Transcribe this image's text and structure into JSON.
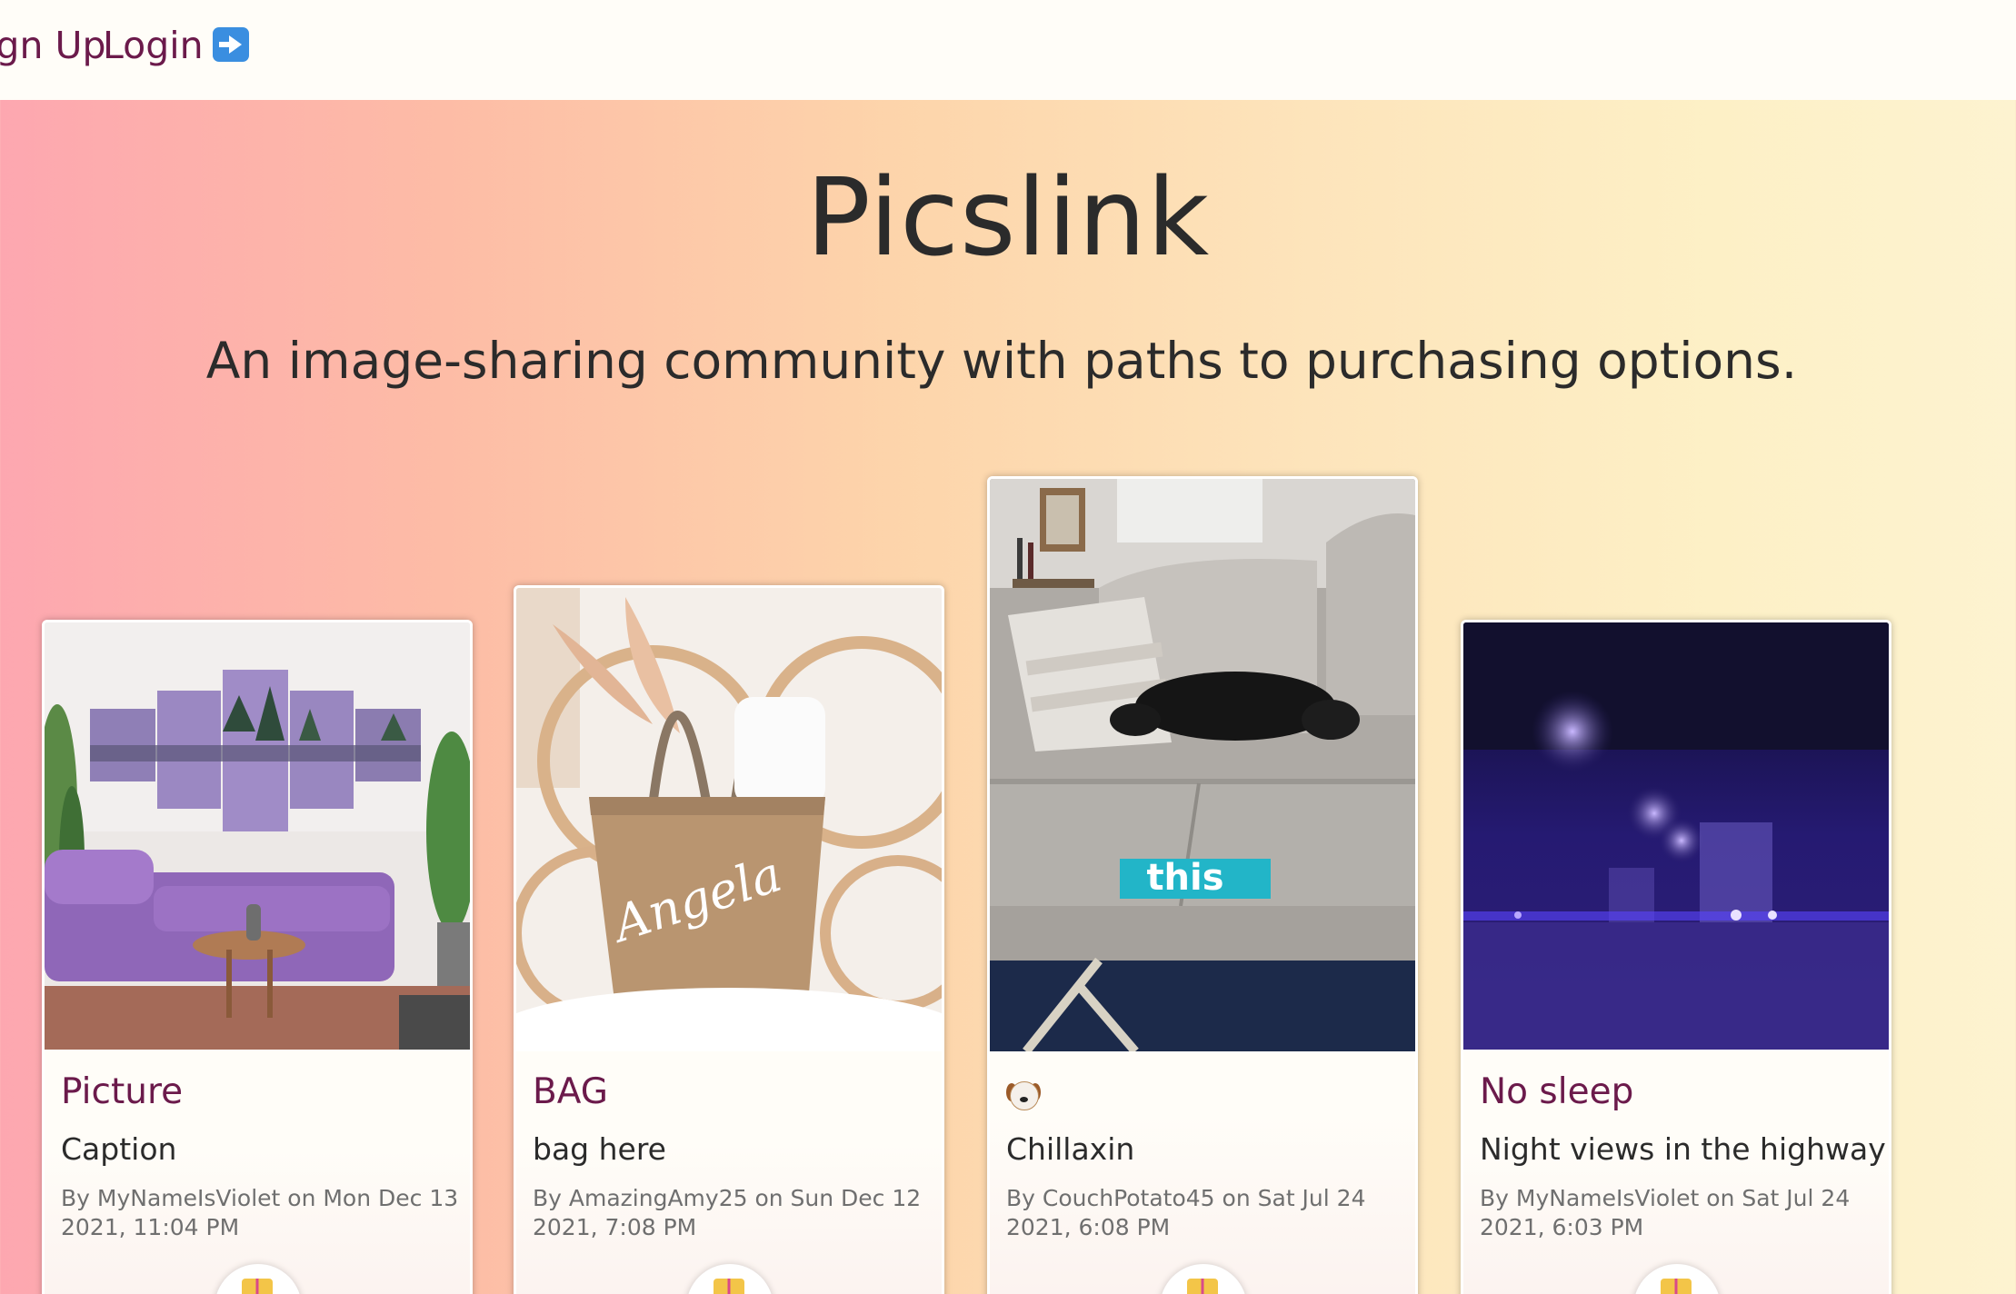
{
  "nav": {
    "signup_label": "Sign Up",
    "login_label": "Login",
    "login_icon": "right-arrow-icon"
  },
  "hero": {
    "title": "Picslink",
    "subtitle": "An image-sharing community with paths to purchasing options."
  },
  "cards": [
    {
      "title": "Picture",
      "caption": "Caption",
      "meta": "By MyNameIsViolet on Mon Dec 13 2021, 11:04 PM",
      "image": "purple-living-room-photo"
    },
    {
      "title": "BAG",
      "caption": "bag here",
      "meta": "By AmazingAmy25 on Sun Dec 12 2021, 7:08 PM",
      "image": "tote-bag-photo"
    },
    {
      "title_icon": "dog-face-emoji",
      "caption": "Chillaxin",
      "meta": "By CouchPotato45 on Sat Jul 24 2021, 6:08 PM",
      "image": "dog-on-couch-gif",
      "image_overlay_text": "this"
    },
    {
      "title": "No sleep",
      "caption": "Night views in the highway",
      "meta": "By MyNameIsViolet on Sat Jul 24 2021, 6:03 PM",
      "image": "night-highway-photo"
    }
  ],
  "colors": {
    "accent": "#6b1a4b",
    "navbar_bg": "#fffdf8",
    "gradient_left": "#fda7b0",
    "gradient_right": "#fdf3d0"
  }
}
